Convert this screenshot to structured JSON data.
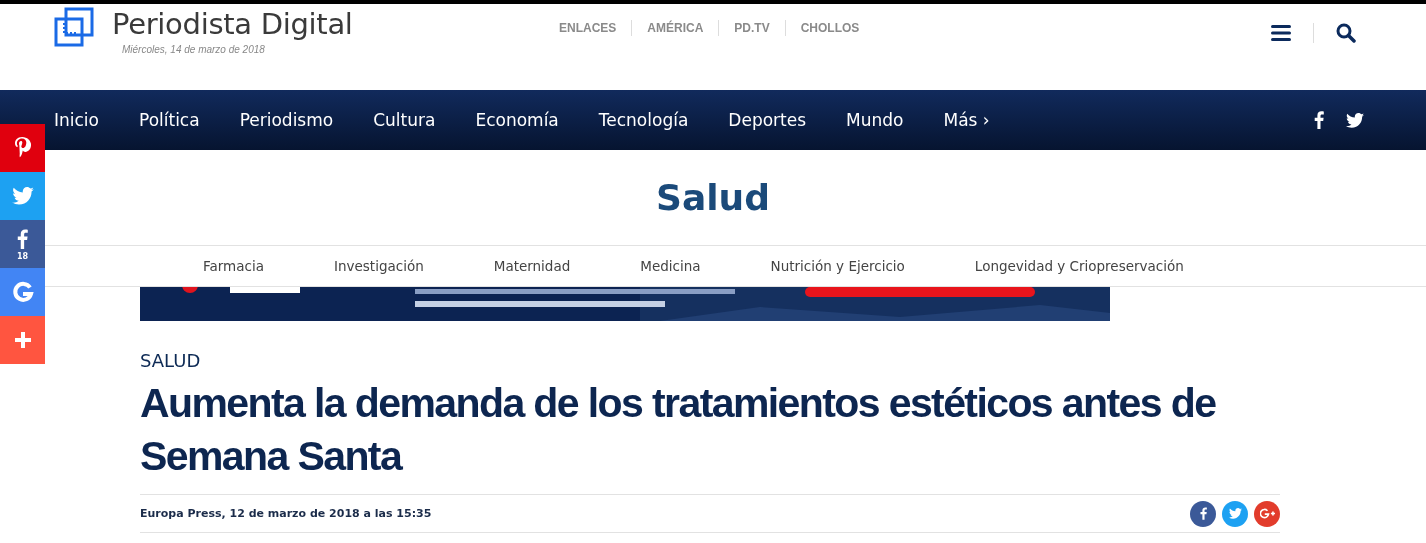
{
  "header": {
    "site_name": "Periodista Digital",
    "date": "Miércoles, 14 de marzo de 2018",
    "top_links": [
      "ENLACES",
      "AMÉRICA",
      "PD.TV",
      "CHOLLOS"
    ]
  },
  "nav": {
    "items": [
      {
        "label": "Inicio"
      },
      {
        "label": "Política"
      },
      {
        "label": "Periodismo"
      },
      {
        "label": "Cultura"
      },
      {
        "label": "Economía"
      },
      {
        "label": "Tecnología"
      },
      {
        "label": "Deportes"
      },
      {
        "label": "Mundo"
      },
      {
        "label": "Más ›"
      }
    ],
    "social": [
      {
        "kind": "facebook"
      },
      {
        "kind": "twitter"
      }
    ]
  },
  "share_bar": [
    {
      "kind": "pinterest",
      "color": "#e0000e"
    },
    {
      "kind": "twitter",
      "color": "#1da1f2"
    },
    {
      "kind": "facebook",
      "color": "#3b5998",
      "count": "18"
    },
    {
      "kind": "google",
      "color": "#4285f4"
    },
    {
      "kind": "more",
      "color": "#ff5540"
    }
  ],
  "section": {
    "title": "Salud",
    "subnav": [
      "Farmacia",
      "Investigación",
      "Maternidad",
      "Medicina",
      "Nutrición y Ejercicio",
      "Longevidad y Criopreservación"
    ]
  },
  "article": {
    "category": "SALUD",
    "headline": "Aumenta la demanda de los tratamientos estéticos antes de Semana Santa",
    "byline": "Europa Press, 12 de marzo de 2018 a las 15:35",
    "share": [
      {
        "kind": "facebook",
        "color": "#3b5998"
      },
      {
        "kind": "twitter",
        "color": "#1da1f2"
      },
      {
        "kind": "google",
        "color": "#e23c2c"
      }
    ]
  }
}
